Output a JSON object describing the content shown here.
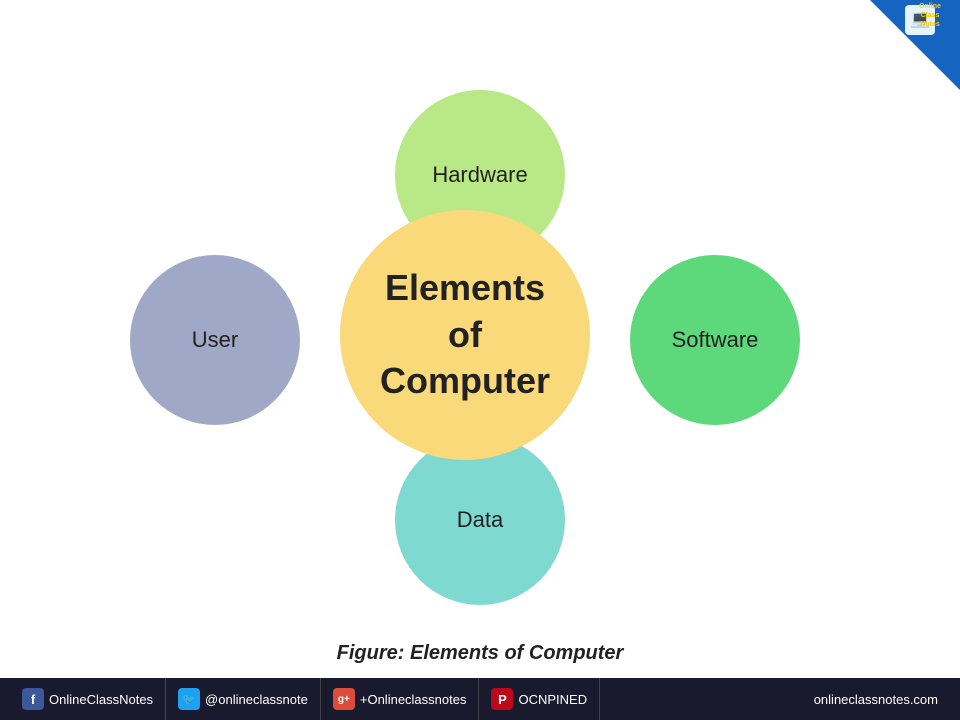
{
  "diagram": {
    "center_label": "Elements\nof\nComputer",
    "circles": {
      "top": {
        "label": "Hardware",
        "color": "#b8e986"
      },
      "right": {
        "label": "Software",
        "color": "#5dd87a"
      },
      "bottom": {
        "label": "Data",
        "color": "#7ed9d0"
      },
      "left": {
        "label": "User",
        "color": "#a0a8c8"
      },
      "center": {
        "label": "Elements of Computer",
        "color": "#f9d97a"
      }
    },
    "caption": "Figure: Elements of Computer"
  },
  "footer": {
    "items": [
      {
        "icon": "f",
        "icon_type": "fb",
        "text": "OnlineClassNotes"
      },
      {
        "icon": "t",
        "icon_type": "tw",
        "text": "@onlineclassnote"
      },
      {
        "icon": "g+",
        "icon_type": "gp",
        "text": "+Onlineclassnotes"
      },
      {
        "icon": "P",
        "icon_type": "pt",
        "text": "OCNPINED"
      }
    ],
    "right_text": "onlineclassnotes.com"
  },
  "badge": {
    "line1": "Online",
    "line2": "Class",
    "line3": "Notes"
  }
}
